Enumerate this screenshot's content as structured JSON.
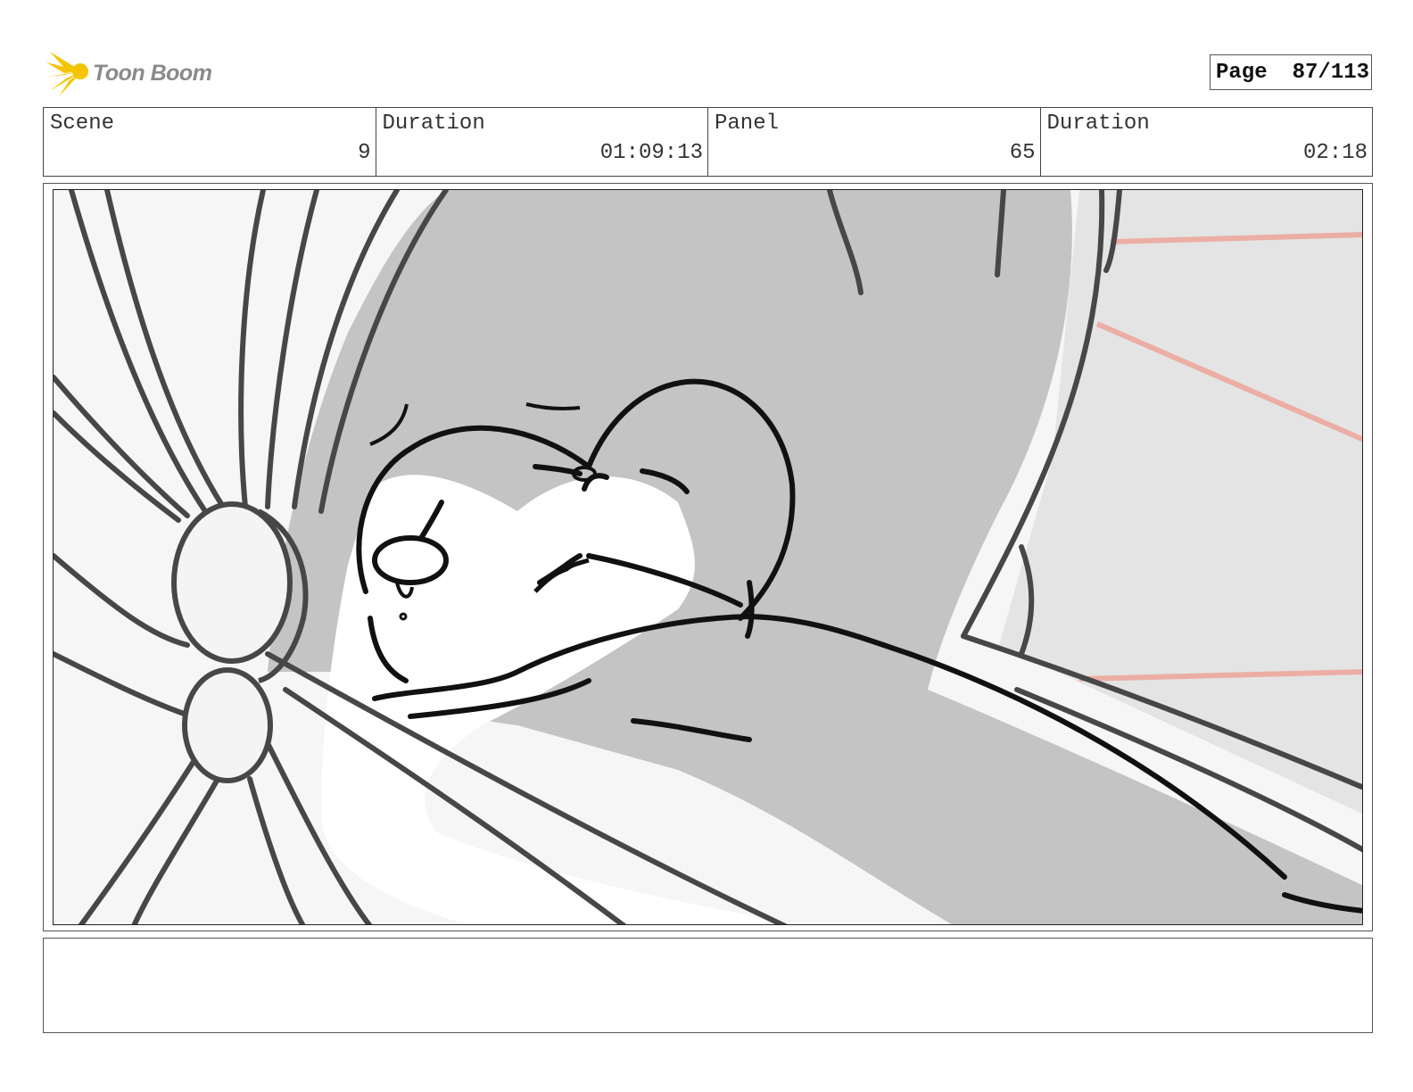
{
  "header": {
    "logo_text": "Toon Boom",
    "page_label": "Page",
    "page_value": "87/113"
  },
  "info": {
    "scene_label": "Scene",
    "scene_value": "9",
    "scene_duration_label": "Duration",
    "scene_duration_value": "01:09:13",
    "panel_label": "Panel",
    "panel_value": "65",
    "panel_duration_label": "Duration",
    "panel_duration_value": "02:18"
  },
  "notes": {
    "text": ""
  },
  "colors": {
    "logo_star": "#f5c400",
    "logo_text": "#8a8a8a",
    "sketch_line": "#444444",
    "sketch_fill": "#c4c4c4",
    "accent_red": "#ecaea4"
  }
}
